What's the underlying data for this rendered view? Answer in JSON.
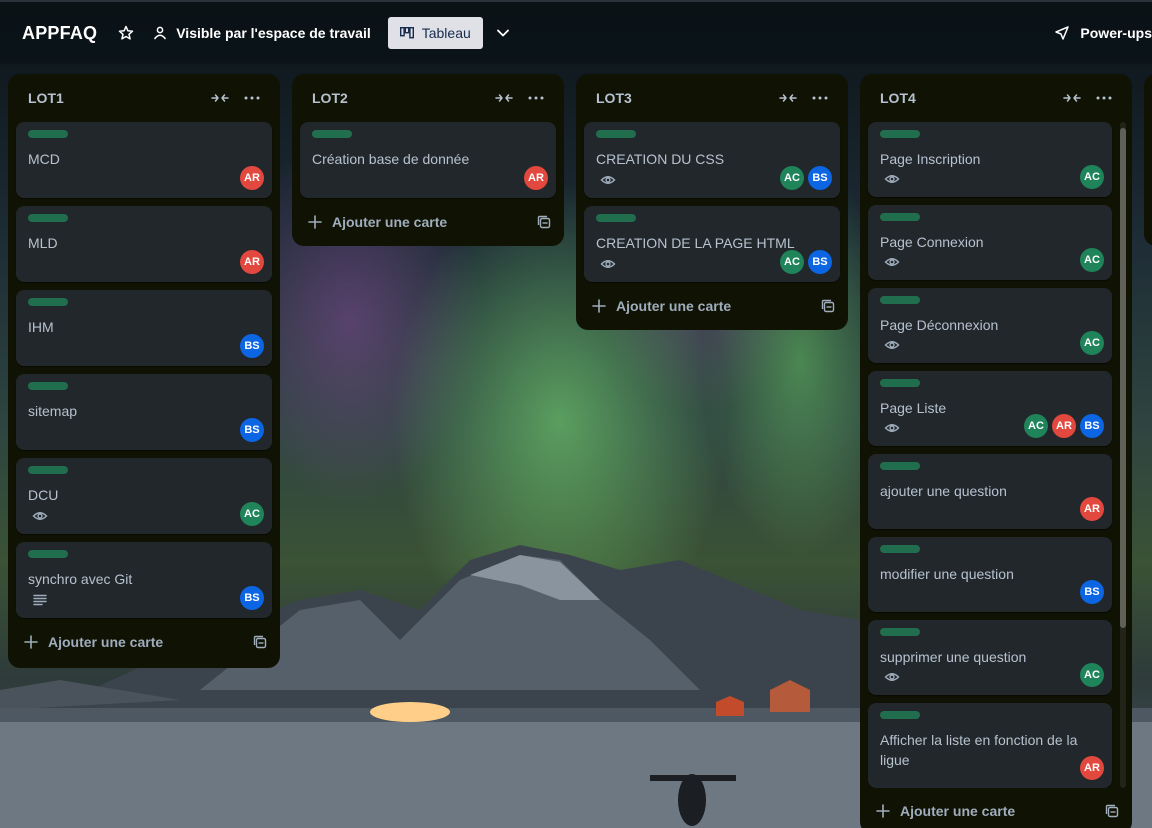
{
  "header": {
    "title": "APPFAQ",
    "visibility_label": "Visible par l'espace de travail",
    "view_label": "Tableau",
    "powerups_label": "Power-ups"
  },
  "colors": {
    "label_green": "#216e4e",
    "avatar_AR": "#e2483d",
    "avatar_AC": "#1f845a",
    "avatar_BS": "#0c66e4",
    "list_bg": "#101204",
    "card_bg": "#22272b"
  },
  "add_card_label": "Ajouter une carte",
  "lists": [
    {
      "title": "LOT1",
      "cards": [
        {
          "title": "MCD",
          "badge": null,
          "members": [
            "AR"
          ]
        },
        {
          "title": "MLD",
          "badge": null,
          "members": [
            "AR"
          ]
        },
        {
          "title": "IHM",
          "badge": null,
          "members": [
            "BS"
          ]
        },
        {
          "title": "sitemap",
          "badge": null,
          "members": [
            "BS"
          ]
        },
        {
          "title": "DCU",
          "badge": "eye-icon",
          "members": [
            "AC"
          ]
        },
        {
          "title": "synchro avec Git",
          "badge": "description-icon",
          "members": [
            "BS"
          ]
        }
      ]
    },
    {
      "title": "LOT2",
      "cards": [
        {
          "title": "Création base de donnée",
          "badge": null,
          "members": [
            "AR"
          ]
        }
      ]
    },
    {
      "title": "LOT3",
      "cards": [
        {
          "title": "CREATION DU CSS",
          "badge": "eye-icon",
          "members": [
            "AC",
            "BS"
          ]
        },
        {
          "title": "CREATION DE LA PAGE HTML",
          "badge": "eye-icon",
          "members": [
            "AC",
            "BS"
          ]
        }
      ]
    },
    {
      "title": "LOT4",
      "cards": [
        {
          "title": "Page Inscription",
          "badge": "eye-icon",
          "members": [
            "AC"
          ]
        },
        {
          "title": "Page Connexion",
          "badge": "eye-icon",
          "members": [
            "AC"
          ]
        },
        {
          "title": "Page Déconnexion",
          "badge": "eye-icon",
          "members": [
            "AC"
          ]
        },
        {
          "title": "Page Liste",
          "badge": "eye-icon",
          "members": [
            "AC",
            "AR",
            "BS"
          ]
        },
        {
          "title": "ajouter une question",
          "badge": null,
          "members": [
            "AR"
          ]
        },
        {
          "title": "modifier une question",
          "badge": null,
          "members": [
            "BS"
          ]
        },
        {
          "title": "supprimer une question",
          "badge": "eye-icon",
          "members": [
            "AC"
          ]
        },
        {
          "title": "Afficher la liste en fonction de la ligue",
          "badge": null,
          "members": [
            "AR"
          ]
        }
      ]
    }
  ]
}
